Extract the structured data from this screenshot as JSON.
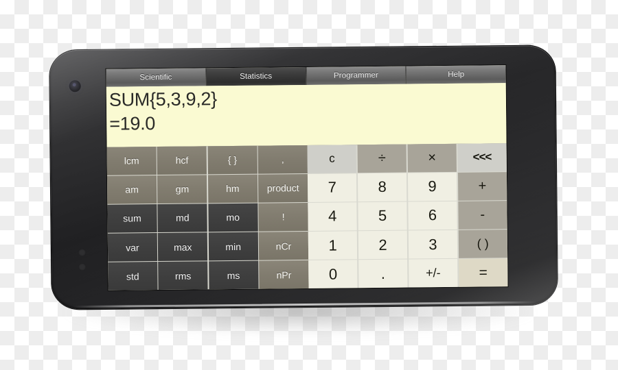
{
  "app": {
    "name": "Calculator",
    "device": "smartphone"
  },
  "tabs": [
    {
      "label": "Scientific",
      "active": false
    },
    {
      "label": "Statistics",
      "active": true
    },
    {
      "label": "Programmer",
      "active": false
    },
    {
      "label": "Help",
      "active": false
    }
  ],
  "display": {
    "expression": "SUM{5,3,9,2}",
    "result": "=19.0",
    "background_color": "#fafad2",
    "text_color": "#2a2a28"
  },
  "function_pad": {
    "rows": [
      [
        {
          "label": "lcm",
          "style": "k-brown"
        },
        {
          "label": "hcf",
          "style": "k-brown"
        },
        {
          "label": "{ }",
          "style": "k-brown"
        },
        {
          "label": ",",
          "style": "k-brown"
        }
      ],
      [
        {
          "label": "am",
          "style": "k-brown"
        },
        {
          "label": "gm",
          "style": "k-brown"
        },
        {
          "label": "hm",
          "style": "k-brown"
        },
        {
          "label": "product",
          "style": "k-brown"
        }
      ],
      [
        {
          "label": "sum",
          "style": "k-dark"
        },
        {
          "label": "md",
          "style": "k-dark"
        },
        {
          "label": "mo",
          "style": "k-dark"
        },
        {
          "label": "!",
          "style": "k-brown"
        }
      ],
      [
        {
          "label": "var",
          "style": "k-dark"
        },
        {
          "label": "max",
          "style": "k-dark"
        },
        {
          "label": "min",
          "style": "k-dark"
        },
        {
          "label": "nCr",
          "style": "k-brown"
        }
      ],
      [
        {
          "label": "std",
          "style": "k-dark"
        },
        {
          "label": "rms",
          "style": "k-dark"
        },
        {
          "label": "ms",
          "style": "k-dark"
        },
        {
          "label": "nPr",
          "style": "k-brown"
        }
      ]
    ]
  },
  "numeric_pad": {
    "rows": [
      [
        {
          "label": "c",
          "style": "k-clear"
        },
        {
          "label": "÷",
          "style": "k-op"
        },
        {
          "label": "×",
          "style": "k-op"
        },
        {
          "label": "<<<",
          "style": "k-back"
        }
      ],
      [
        {
          "label": "7",
          "style": "k-num"
        },
        {
          "label": "8",
          "style": "k-num"
        },
        {
          "label": "9",
          "style": "k-num"
        },
        {
          "label": "+",
          "style": "k-op"
        }
      ],
      [
        {
          "label": "4",
          "style": "k-num"
        },
        {
          "label": "5",
          "style": "k-num"
        },
        {
          "label": "6",
          "style": "k-num"
        },
        {
          "label": "-",
          "style": "k-op"
        }
      ],
      [
        {
          "label": "1",
          "style": "k-num"
        },
        {
          "label": "2",
          "style": "k-num"
        },
        {
          "label": "3",
          "style": "k-num"
        },
        {
          "label": "( )",
          "style": "k-op k-small"
        }
      ],
      [
        {
          "label": "0",
          "style": "k-num"
        },
        {
          "label": ".",
          "style": "k-num"
        },
        {
          "label": "+/-",
          "style": "k-num k-small"
        },
        {
          "label": "=",
          "style": "k-eq"
        }
      ]
    ]
  },
  "colors": {
    "bezel": "#232325",
    "tab_inactive": "#6a6a6a",
    "tab_active": "#353535",
    "key_brown": "#817c6f",
    "key_dark": "#3f3f3f",
    "key_number": "#f0efe3",
    "key_operator": "#a8a499",
    "key_clear": "#cfcfc9"
  }
}
